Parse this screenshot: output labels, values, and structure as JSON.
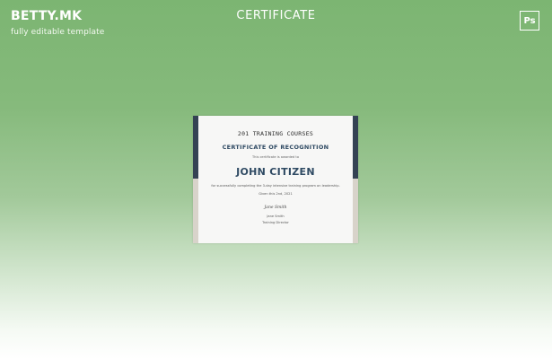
{
  "header": {
    "brand": "BETTY.MK",
    "tagline": "fully editable template",
    "title": "CERTIFICATE",
    "app_badge": "Ps"
  },
  "certificate": {
    "organization": "201 TRAINING COURSES",
    "title": "CERTIFICATE OF RECOGNITION",
    "awarded_to": "This certificate is awarded to",
    "recipient": "JOHN CITIZEN",
    "description": "for successfully completing the 3-day intensive training program on leadership.",
    "date": "Given this 2nd, 2021",
    "signature": "Jane Smith",
    "signer_name": "Jane Smith",
    "signer_role": "Training Director"
  },
  "colors": {
    "background_top": "#7cb572",
    "background_bottom": "#ffffff",
    "accent_dark": "#344254",
    "accent_light": "#d8d3ca",
    "title_blue": "#2f4a63"
  },
  "icons": {
    "app_badge": "photoshop-icon"
  }
}
